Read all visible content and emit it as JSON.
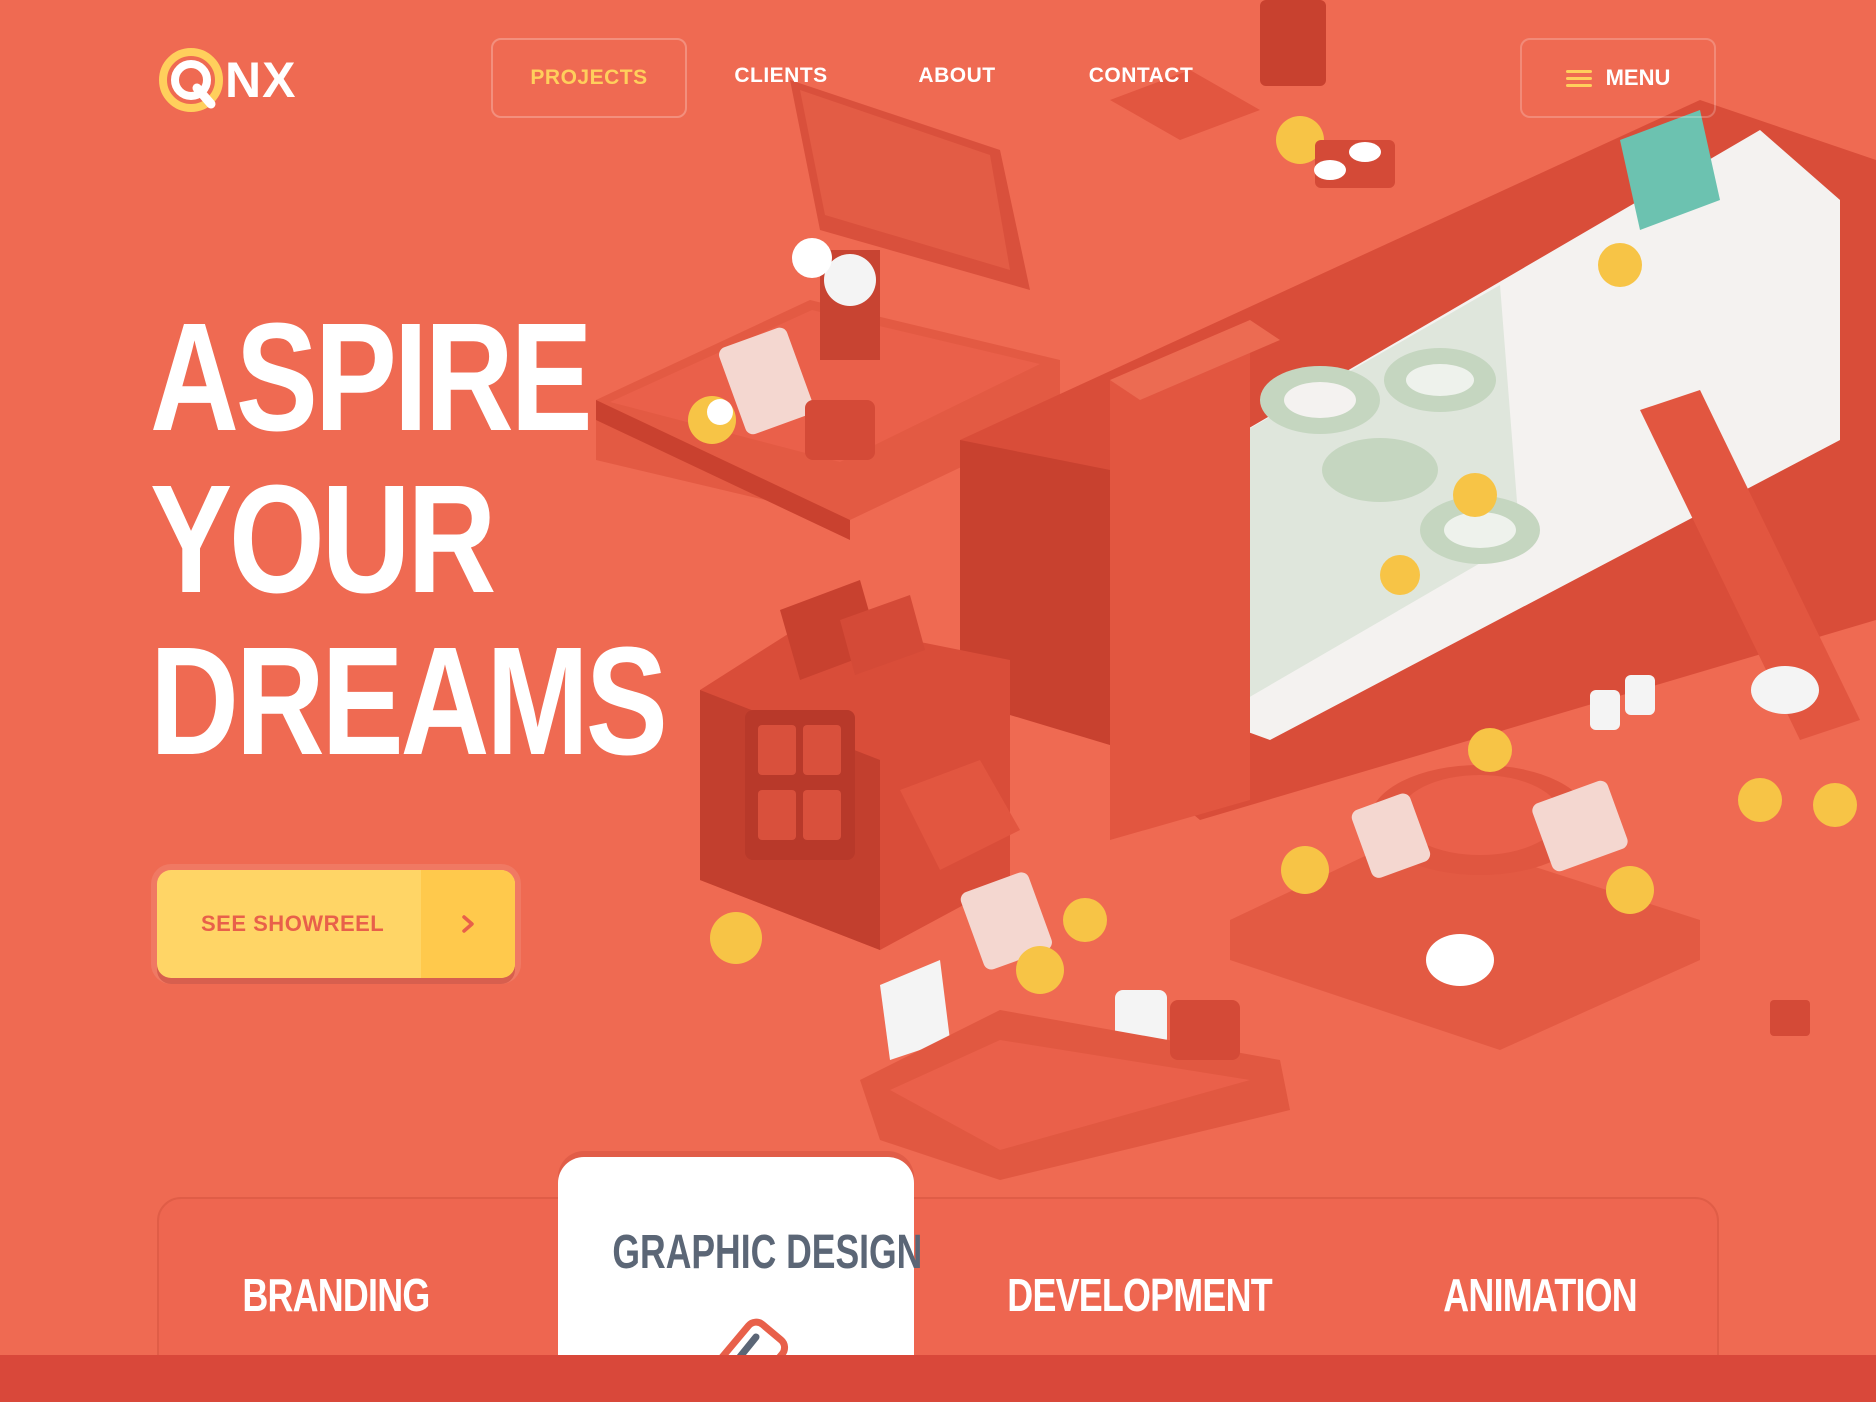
{
  "brand": {
    "logo_text": "NX",
    "logo_letter": "Q"
  },
  "nav": {
    "items": [
      {
        "label": "PROJECTS",
        "active": true
      },
      {
        "label": "CLIENTS",
        "active": false
      },
      {
        "label": "ABOUT",
        "active": false
      },
      {
        "label": "CONTACT",
        "active": false
      }
    ],
    "menu_label": "MENU"
  },
  "hero": {
    "title_lines": [
      "ASPIRE",
      "YOUR",
      "DREAMS"
    ],
    "cta_label": "SEE SHOWREEL"
  },
  "services": [
    {
      "label": "BRANDING"
    },
    {
      "label": "GRAPHIC DESIGN",
      "selected": true
    },
    {
      "label": "DEVELOPMENT"
    },
    {
      "label": "ANIMATION"
    }
  ],
  "icons": {
    "logo": "qnx-logo-icon",
    "menu": "hamburger-icon",
    "cta_arrow": "chevron-right-icon",
    "graphic_design": "pen-tool-icon",
    "branding": "branding-icon"
  },
  "colors": {
    "background": "#ef6a52",
    "accent_yellow": "#ffcf5c",
    "button_yellow": "#ffd566",
    "dark_red": "#d9483a",
    "card_text": "#5b6676",
    "white": "#ffffff"
  }
}
